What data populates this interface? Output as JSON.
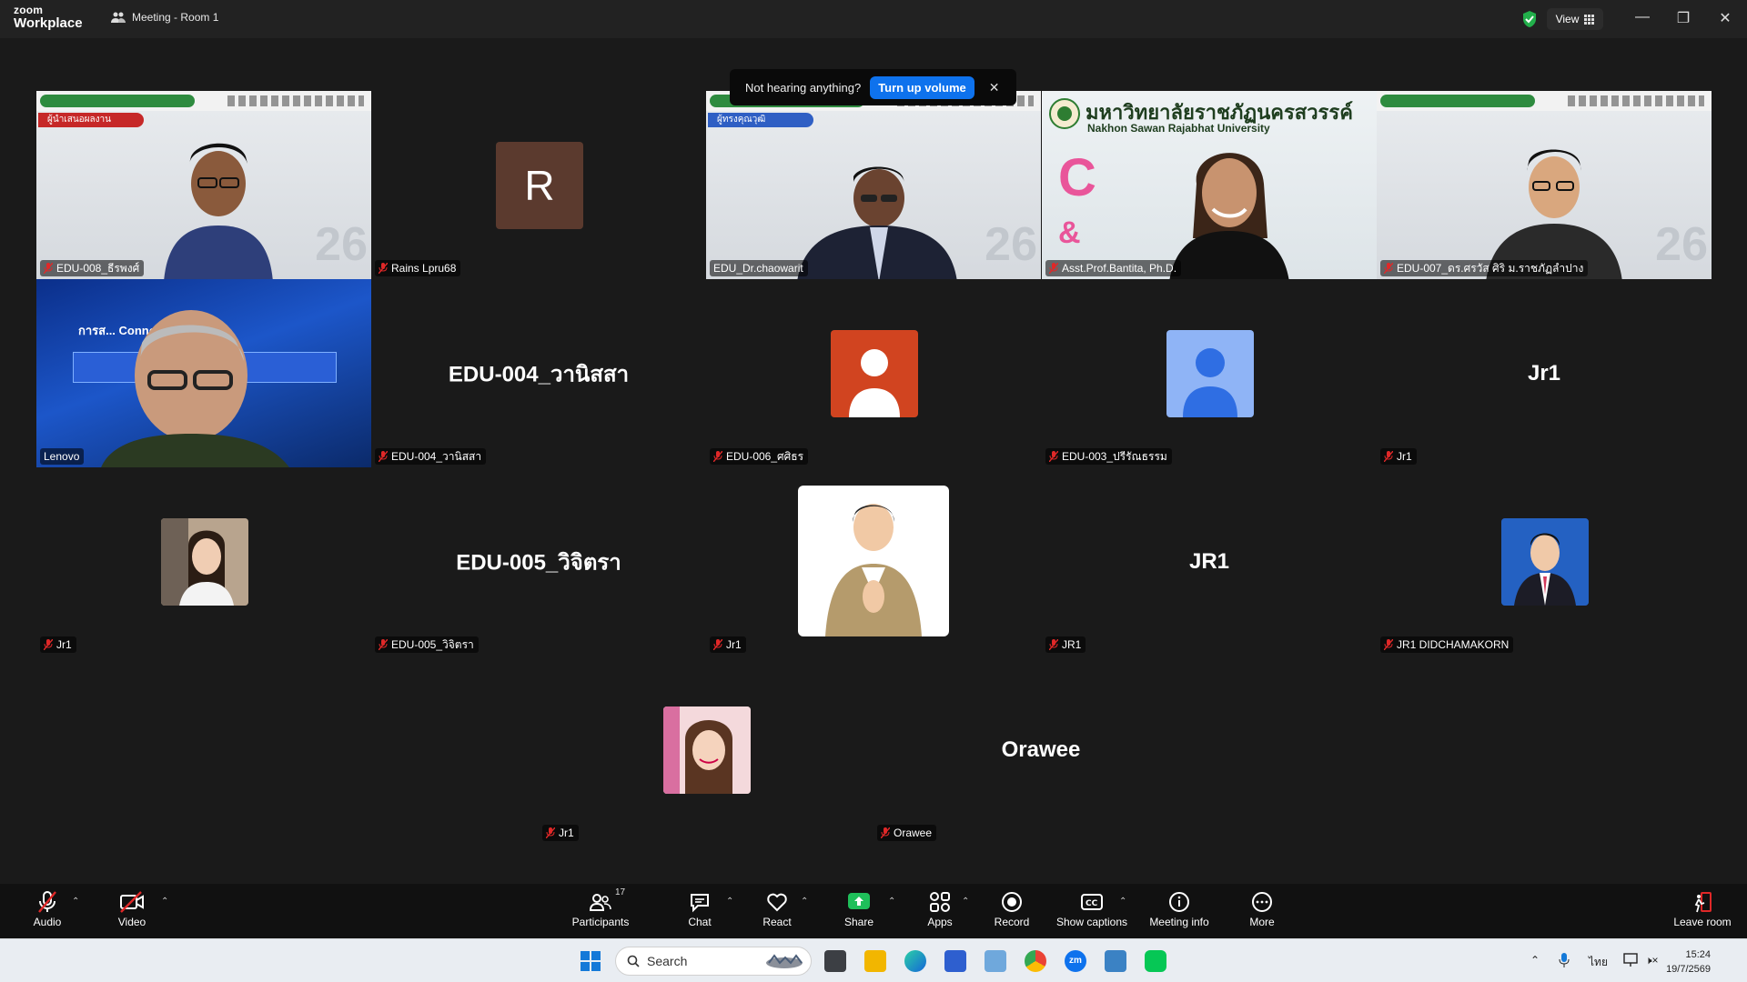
{
  "titlebar": {
    "logo_top": "zoom",
    "logo_bottom": "Workplace",
    "meeting_title": "Meeting - Room 1",
    "view_label": "View",
    "minimize": "—",
    "restore": "❐",
    "close": "✕"
  },
  "toast": {
    "message": "Not hearing anything?",
    "button": "Turn up volume",
    "close": "✕"
  },
  "tiles": {
    "t1": {
      "name": "EDU-008_ธีรพงศ์"
    },
    "t2": {
      "name": "Rains Lpru68",
      "initial": "R"
    },
    "t3": {
      "name": "EDU_Dr.chaowarit",
      "banner": "ผู้ทรงคุณวุฒิ"
    },
    "t4": {
      "name": "Asst.Prof.Bantita, Ph.D.",
      "uni_thai": "มหาวิทยาลัยราชภัฏนครสวรรค์",
      "uni_en": "Nakhon Sawan Rajabhat University"
    },
    "t5": {
      "name": "EDU-007_ดร.ศรวัส ศิริ ม.ราชภัฏลำปาง"
    },
    "t6": {
      "name": "Lenovo",
      "slide_text": "การส... Connoisseurship)"
    },
    "t7": {
      "name": "EDU-004_วานิสสา",
      "display": "EDU-004_วานิสสา"
    },
    "t8": {
      "name": "EDU-006_ศศิธร"
    },
    "t9": {
      "name": "EDU-003_ปรีรัณธรรม"
    },
    "t10": {
      "name": "Jr1",
      "display": "Jr1"
    },
    "t11": {
      "name": "Jr1"
    },
    "t12": {
      "name": "EDU-005_วิจิตรา",
      "display": "EDU-005_วิจิตรา"
    },
    "t13": {
      "name": "Jr1"
    },
    "t14": {
      "name": "JR1",
      "display": "JR1"
    },
    "t15": {
      "name": "JR1 DIDCHAMAKORN"
    },
    "t16": {
      "name": "Jr1"
    },
    "t17": {
      "name": "Orawee",
      "display": "Orawee"
    }
  },
  "toolbar": {
    "audio": "Audio",
    "video": "Video",
    "participants": "Participants",
    "participants_count": "17",
    "chat": "Chat",
    "react": "React",
    "share": "Share",
    "apps": "Apps",
    "record": "Record",
    "captions": "Show captions",
    "meeting_info": "Meeting info",
    "more": "More",
    "leave": "Leave room",
    "caret": "⌃"
  },
  "taskbar": {
    "search_placeholder": "Search",
    "lang": "ไทย",
    "time": "15:24",
    "date": "19/7/2569"
  },
  "colors": {
    "accent_blue": "#0e72ed",
    "active_green": "#4ec46a",
    "mute_red": "#e02828",
    "share_green": "#1fbf5a"
  }
}
